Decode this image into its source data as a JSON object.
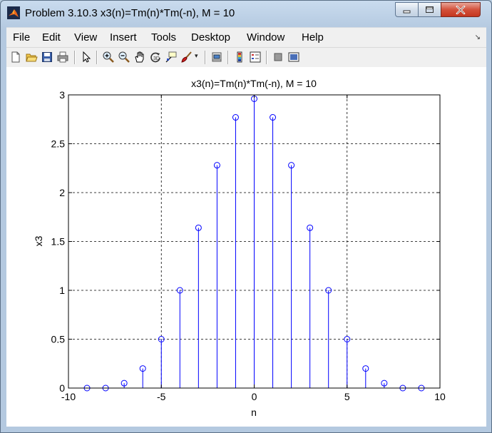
{
  "window": {
    "title": "Problem 3.10.3 x3(n)=Tm(n)*Tm(-n), M = 10",
    "controls": {
      "minimize": "minimize-icon",
      "maximize": "maximize-icon",
      "close": "close-icon"
    }
  },
  "menu": {
    "items": [
      {
        "label": "File"
      },
      {
        "label": "Edit"
      },
      {
        "label": "View"
      },
      {
        "label": "Insert"
      },
      {
        "label": "Tools"
      },
      {
        "label": "Desktop"
      },
      {
        "label": "Window"
      },
      {
        "label": "Help"
      }
    ]
  },
  "toolbar": {
    "buttons": [
      {
        "name": "new-figure",
        "icon": "new-file-icon"
      },
      {
        "name": "open-file",
        "icon": "folder-open-icon"
      },
      {
        "name": "save-figure",
        "icon": "save-icon"
      },
      {
        "name": "print-figure",
        "icon": "printer-icon"
      },
      {
        "name": "edit-plot",
        "icon": "cursor-arrow-icon"
      },
      {
        "name": "zoom-in",
        "icon": "zoom-in-icon"
      },
      {
        "name": "zoom-out",
        "icon": "zoom-out-icon"
      },
      {
        "name": "pan",
        "icon": "hand-icon"
      },
      {
        "name": "rotate-3d",
        "icon": "rotate-icon"
      },
      {
        "name": "data-cursor",
        "icon": "data-cursor-icon"
      },
      {
        "name": "brush",
        "icon": "brush-icon"
      },
      {
        "name": "link-plot",
        "icon": "link-icon"
      },
      {
        "name": "colorbar",
        "icon": "colorbar-icon"
      },
      {
        "name": "legend",
        "icon": "legend-icon"
      },
      {
        "name": "hide-plot-tools",
        "icon": "hide-tools-icon"
      },
      {
        "name": "show-plot-tools",
        "icon": "show-tools-icon"
      }
    ]
  },
  "colors": {
    "stem": "#0000ff",
    "axis": "#000000",
    "grid": "#000000",
    "background": "#ffffff"
  },
  "chart_data": {
    "type": "stem",
    "title": "x3(n)=Tm(n)*Tm(-n), M = 10",
    "xlabel": "n",
    "ylabel": "x3",
    "xlim": [
      -10,
      10
    ],
    "ylim": [
      0,
      3
    ],
    "xticks": [
      -10,
      -5,
      0,
      5,
      10
    ],
    "yticks": [
      0,
      0.5,
      1,
      1.5,
      2,
      2.5,
      3
    ],
    "grid": true,
    "x": [
      -9,
      -8,
      -7,
      -6,
      -5,
      -4,
      -3,
      -2,
      -1,
      0,
      1,
      2,
      3,
      4,
      5,
      6,
      7,
      8,
      9
    ],
    "values": [
      0,
      0,
      0.05,
      0.2,
      0.5,
      1.0,
      1.64,
      2.28,
      2.77,
      2.96,
      2.77,
      2.28,
      1.64,
      1.0,
      0.5,
      0.2,
      0.05,
      0,
      0
    ]
  }
}
